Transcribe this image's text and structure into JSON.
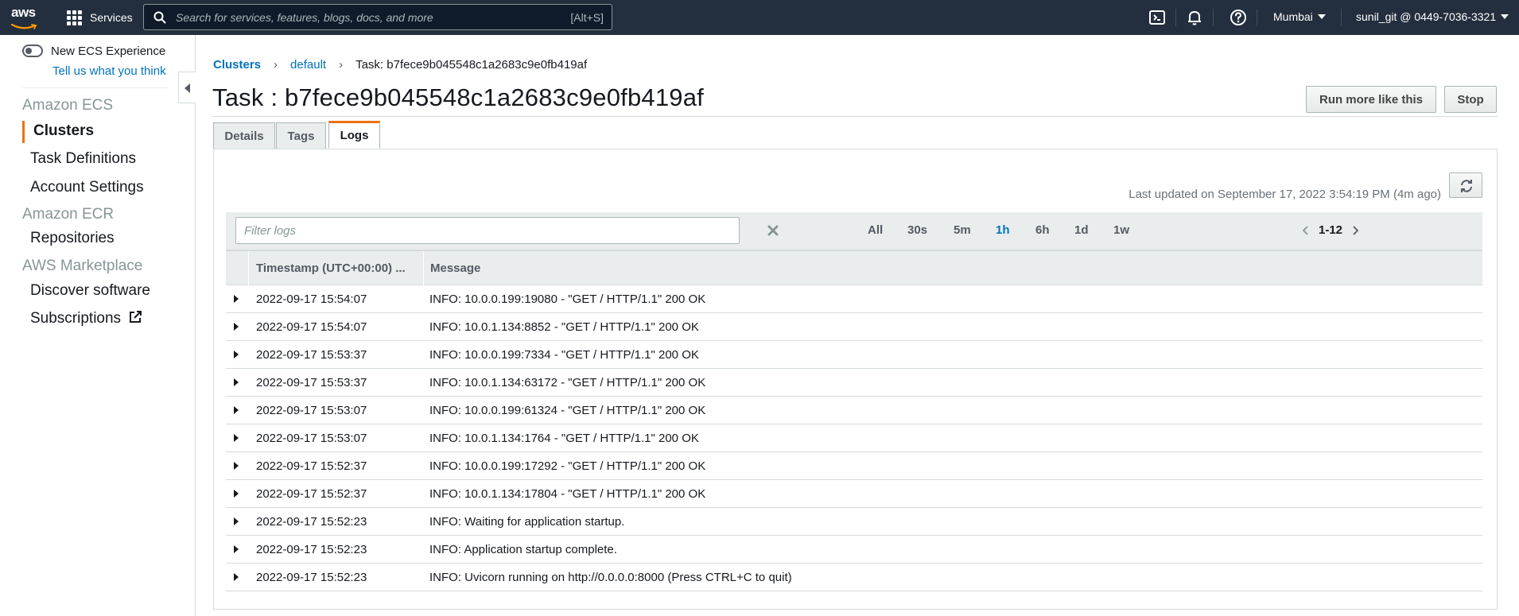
{
  "topnav": {
    "logo_text": "aws",
    "services_label": "Services",
    "search_placeholder": "Search for services, features, blogs, docs, and more",
    "search_shortcut": "[Alt+S]",
    "region": "Mumbai",
    "account": "sunil_git @ 0449-7036-3321"
  },
  "sidebar": {
    "new_experience_label": "New ECS Experience",
    "tell_us_link": "Tell us what you think",
    "sections": [
      {
        "title": "Amazon ECS",
        "items": [
          "Clusters",
          "Task Definitions",
          "Account Settings"
        ]
      },
      {
        "title": "Amazon ECR",
        "items": [
          "Repositories"
        ]
      },
      {
        "title": "AWS Marketplace",
        "items": [
          "Discover software",
          "Subscriptions"
        ]
      }
    ],
    "active_item": "Clusters"
  },
  "breadcrumb": {
    "clusters": "Clusters",
    "cluster_name": "default",
    "current": "Task: b7fece9b045548c1a2683c9e0fb419af"
  },
  "page": {
    "title": "Task : b7fece9b045548c1a2683c9e0fb419af",
    "run_more_label": "Run more like this",
    "stop_label": "Stop",
    "tabs": [
      "Details",
      "Tags",
      "Logs"
    ],
    "active_tab": "Logs"
  },
  "logs": {
    "last_updated": "Last updated on September 17, 2022 3:54:19 PM (4m ago)",
    "filter_placeholder": "Filter logs",
    "ranges": [
      "All",
      "30s",
      "5m",
      "1h",
      "6h",
      "1d",
      "1w"
    ],
    "active_range": "1h",
    "pager_label": "1-12",
    "columns": [
      "Timestamp (UTC+00:00) ...",
      "Message"
    ],
    "rows": [
      {
        "timestamp": "2022-09-17 15:54:07",
        "message": "INFO: 10.0.0.199:19080 - \"GET / HTTP/1.1\" 200 OK"
      },
      {
        "timestamp": "2022-09-17 15:54:07",
        "message": "INFO: 10.0.1.134:8852 - \"GET / HTTP/1.1\" 200 OK"
      },
      {
        "timestamp": "2022-09-17 15:53:37",
        "message": "INFO: 10.0.0.199:7334 - \"GET / HTTP/1.1\" 200 OK"
      },
      {
        "timestamp": "2022-09-17 15:53:37",
        "message": "INFO: 10.0.1.134:63172 - \"GET / HTTP/1.1\" 200 OK"
      },
      {
        "timestamp": "2022-09-17 15:53:07",
        "message": "INFO: 10.0.0.199:61324 - \"GET / HTTP/1.1\" 200 OK"
      },
      {
        "timestamp": "2022-09-17 15:53:07",
        "message": "INFO: 10.0.1.134:1764 - \"GET / HTTP/1.1\" 200 OK"
      },
      {
        "timestamp": "2022-09-17 15:52:37",
        "message": "INFO: 10.0.0.199:17292 - \"GET / HTTP/1.1\" 200 OK"
      },
      {
        "timestamp": "2022-09-17 15:52:37",
        "message": "INFO: 10.0.1.134:17804 - \"GET / HTTP/1.1\" 200 OK"
      },
      {
        "timestamp": "2022-09-17 15:52:23",
        "message": "INFO: Waiting for application startup."
      },
      {
        "timestamp": "2022-09-17 15:52:23",
        "message": "INFO: Application startup complete."
      },
      {
        "timestamp": "2022-09-17 15:52:23",
        "message": "INFO: Uvicorn running on http://0.0.0.0:8000 (Press CTRL+C to quit)"
      }
    ]
  },
  "colors": {
    "nav_bg": "#232f3e",
    "link": "#0073bb",
    "accent": "#ec7211"
  }
}
